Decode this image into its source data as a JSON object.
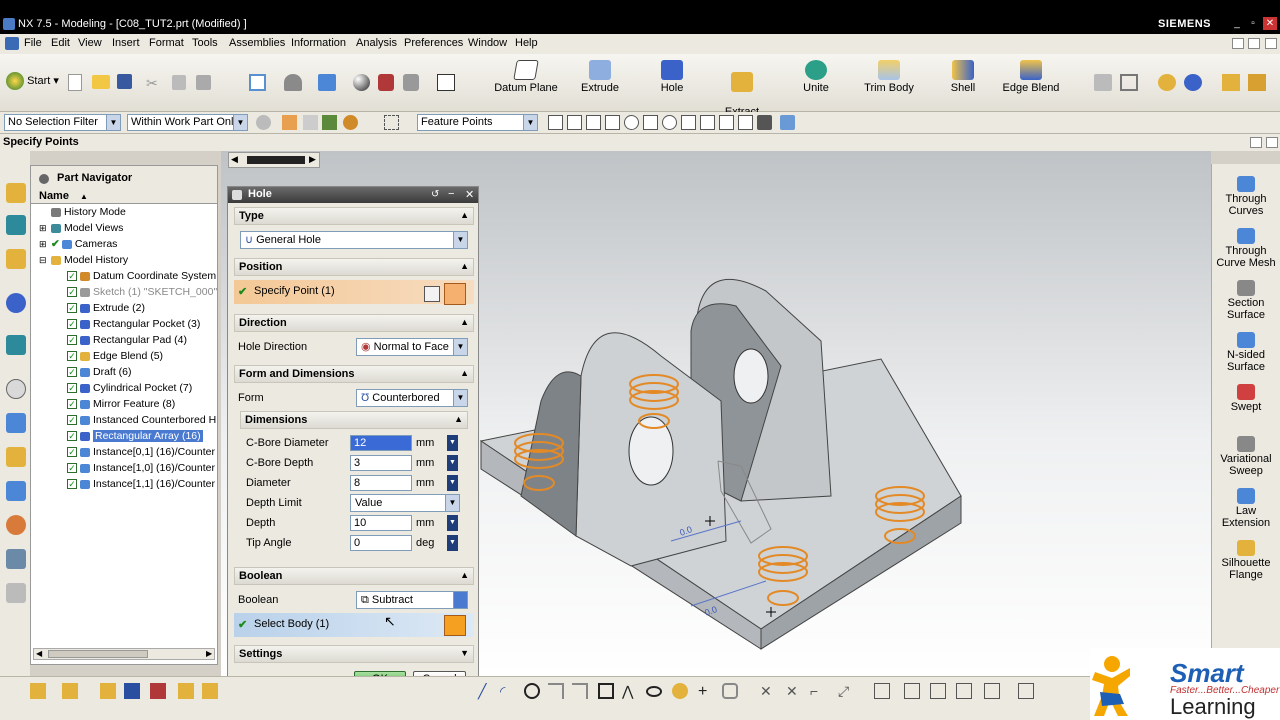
{
  "window": {
    "title": "NX 7.5 - Modeling - [C08_TUT2.prt (Modified) ]",
    "brand": "SIEMENS"
  },
  "menu": [
    "File",
    "Edit",
    "View",
    "Insert",
    "Format",
    "Tools",
    "Assemblies",
    "Information",
    "Analysis",
    "Preferences",
    "Window",
    "Help"
  ],
  "toolbar": {
    "start": "Start",
    "commands": [
      {
        "label": "Datum Plane"
      },
      {
        "label": "Extrude"
      },
      {
        "label": "Hole"
      },
      {
        "label": "Extract\nBody"
      },
      {
        "label": "Unite"
      },
      {
        "label": "Trim Body"
      },
      {
        "label": "Shell"
      },
      {
        "label": "Edge Blend"
      }
    ]
  },
  "selection_bar": {
    "filter": "No Selection Filter",
    "scope": "Within Work Part Only",
    "snap": "Feature Points"
  },
  "cue_line": "Specify Points",
  "navigator": {
    "title": "Part Navigator",
    "column": "Name",
    "items": [
      {
        "label": "History Mode",
        "level": 0
      },
      {
        "label": "Model Views",
        "level": 0
      },
      {
        "label": "Cameras",
        "level": 0
      },
      {
        "label": "Model History",
        "level": 0
      },
      {
        "label": "Datum Coordinate System",
        "level": 1
      },
      {
        "label": "Sketch (1) \"SKETCH_000\"",
        "level": 1,
        "dim": true
      },
      {
        "label": "Extrude (2)",
        "level": 1
      },
      {
        "label": "Rectangular Pocket (3)",
        "level": 1
      },
      {
        "label": "Rectangular Pad (4)",
        "level": 1
      },
      {
        "label": "Edge Blend (5)",
        "level": 1
      },
      {
        "label": "Draft (6)",
        "level": 1
      },
      {
        "label": "Cylindrical Pocket (7)",
        "level": 1
      },
      {
        "label": "Mirror Feature (8)",
        "level": 1
      },
      {
        "label": "Instanced Counterbored H",
        "level": 1
      },
      {
        "label": "Rectangular Array (16)",
        "level": 1,
        "selected": true
      },
      {
        "label": "Instance[0,1] (16)/Counter",
        "level": 1
      },
      {
        "label": "Instance[1,0] (16)/Counter",
        "level": 1
      },
      {
        "label": "Instance[1,1] (16)/Counter",
        "level": 1
      }
    ]
  },
  "dialog": {
    "title": "Hole",
    "type": {
      "header": "Type",
      "value": "General Hole"
    },
    "position": {
      "header": "Position",
      "specify": "Specify Point (1)"
    },
    "direction": {
      "header": "Direction",
      "label": "Hole Direction",
      "value": "Normal to Face"
    },
    "form": {
      "header": "Form and Dimensions",
      "label": "Form",
      "value": "Counterbored",
      "dims_header": "Dimensions",
      "fields": [
        {
          "label": "C-Bore Diameter",
          "value": "12",
          "unit": "mm"
        },
        {
          "label": "C-Bore Depth",
          "value": "3",
          "unit": "mm"
        },
        {
          "label": "Diameter",
          "value": "8",
          "unit": "mm"
        },
        {
          "label": "Depth Limit",
          "value": "Value",
          "unit": ""
        },
        {
          "label": "Depth",
          "value": "10",
          "unit": "mm"
        },
        {
          "label": "Tip Angle",
          "value": "0",
          "unit": "deg"
        }
      ]
    },
    "boolean": {
      "header": "Boolean",
      "label": "Boolean",
      "value": "Subtract",
      "select": "Select Body (1)"
    },
    "settings": {
      "header": "Settings"
    },
    "ok": "OK",
    "cancel": "Cancel"
  },
  "palette": [
    {
      "label": "Through\nCurves"
    },
    {
      "label": "Through\nCurve Mesh"
    },
    {
      "label": "Section\nSurface"
    },
    {
      "label": "N-sided\nSurface"
    },
    {
      "label": "Swept"
    },
    {
      "label": "Variational\nSweep"
    },
    {
      "label": "Law\nExtension"
    },
    {
      "label": "Silhouette\nFlange"
    }
  ],
  "viewport": {
    "dim_labels": [
      "0.0",
      "0.0"
    ]
  },
  "logo": {
    "brand": "Smart",
    "tagline": "Faster...Better...Cheaper",
    "word": "Learning"
  },
  "colors": {
    "accent": "#e38a26",
    "selection": "#b9d1ea",
    "dialog_title": "#3a3a3a",
    "highlight_row": "#f1d0a8"
  }
}
